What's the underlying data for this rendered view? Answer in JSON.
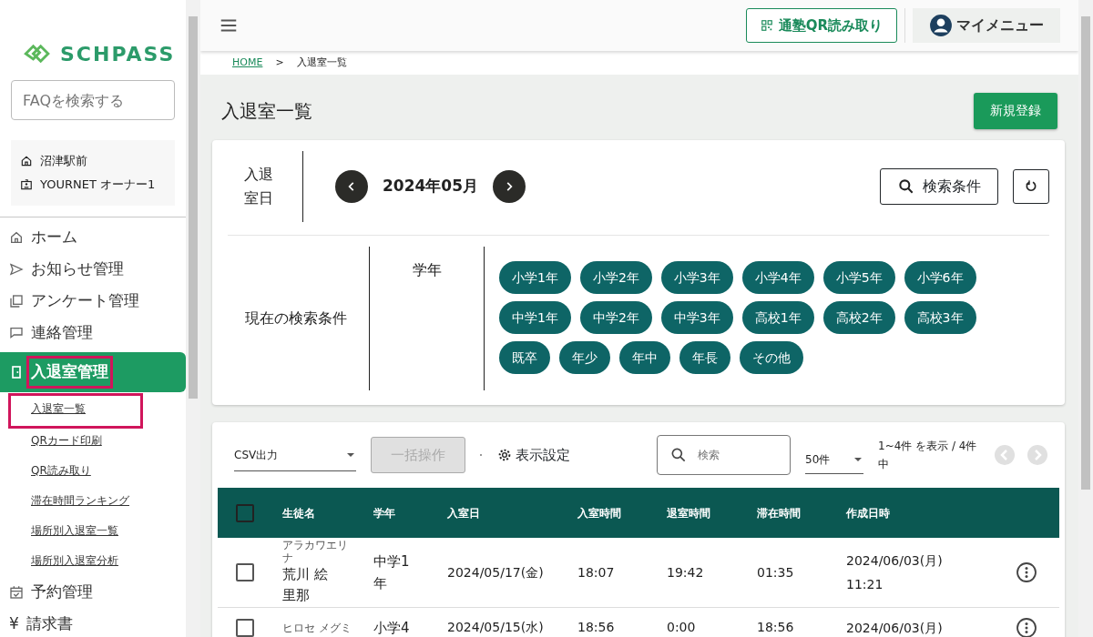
{
  "sidebar": {
    "logo": "SCHPASS",
    "faq_search": {
      "placeholder": "FAQを検索する"
    },
    "school": "沼津駅前",
    "user": "YOURNET オーナー1",
    "nav": [
      {
        "kind": "home",
        "label": "ホーム",
        "selected": false,
        "highlighted": false
      },
      {
        "kind": "notice",
        "label": "お知らせ管理",
        "selected": false,
        "highlighted": false
      },
      {
        "kind": "survey",
        "label": "アンケート管理",
        "selected": false,
        "highlighted": false
      },
      {
        "kind": "contact",
        "label": "連絡管理",
        "selected": false,
        "highlighted": false
      },
      {
        "kind": "entry",
        "label": "入退室管理",
        "selected": true,
        "highlighted": true,
        "children": [
          {
            "label": "入退室一覧",
            "highlighted": true
          },
          {
            "label": "QRカード印刷",
            "highlighted": false
          },
          {
            "label": "QR読み取り",
            "highlighted": false
          },
          {
            "label": "滞在時間ランキング",
            "highlighted": false
          },
          {
            "label": "場所別入退室一覧",
            "highlighted": false
          },
          {
            "label": "場所別入退室分析",
            "highlighted": false
          }
        ]
      },
      {
        "kind": "reservation",
        "label": "予約管理",
        "selected": false,
        "highlighted": false
      },
      {
        "kind": "billing",
        "symbol": "¥",
        "label": "請求書",
        "selected": false,
        "highlighted": false
      }
    ]
  },
  "header": {
    "qr_button": "通塾QR読み取り",
    "my_menu": "マイメニュー"
  },
  "breadcrumb": {
    "items": [
      "HOME",
      "入退室一覧"
    ],
    "separator": ">"
  },
  "page_title": "入退室一覧",
  "new_button": "新規登録",
  "filter": {
    "date_label": "入退室日",
    "month": "2024年05月",
    "search_button": "検索条件",
    "current_label": "現在の検索条件",
    "field": "学年",
    "chips": [
      "小学1年",
      "小学2年",
      "小学3年",
      "小学4年",
      "小学5年",
      "小学6年",
      "中学1年",
      "中学2年",
      "中学3年",
      "高校1年",
      "高校2年",
      "高校3年",
      "既卒",
      "年少",
      "年中",
      "年長",
      "その他"
    ]
  },
  "list": {
    "csv": "CSV出力",
    "bulk": {
      "label": "一括操作",
      "disabled": true
    },
    "display_settings": "表示設定",
    "search": {
      "placeholder": "検索"
    },
    "per_page": "50件",
    "range": "1~4件 を表示 / 4件中",
    "all_checked": false,
    "columns": [
      "生徒名",
      "学年",
      "入室日",
      "入室時間",
      "退室時間",
      "滞在時間",
      "作成日時"
    ],
    "rows": [
      {
        "checked": false,
        "kana": "アラカワエリナ",
        "name": "荒川 絵里那",
        "grade": "中学1年",
        "date": "2024/05/17(金)",
        "in": "18:07",
        "out": "19:42",
        "stay": "01:35",
        "created": "2024/06/03(月) 11:21"
      },
      {
        "checked": false,
        "kana": "ヒロセ メグミ",
        "grade": "小学4",
        "date": "2024/05/15(水)",
        "in": "18:56",
        "out": "0:00",
        "stay": "18:56",
        "created": "2024/06/03(月)"
      }
    ]
  }
}
